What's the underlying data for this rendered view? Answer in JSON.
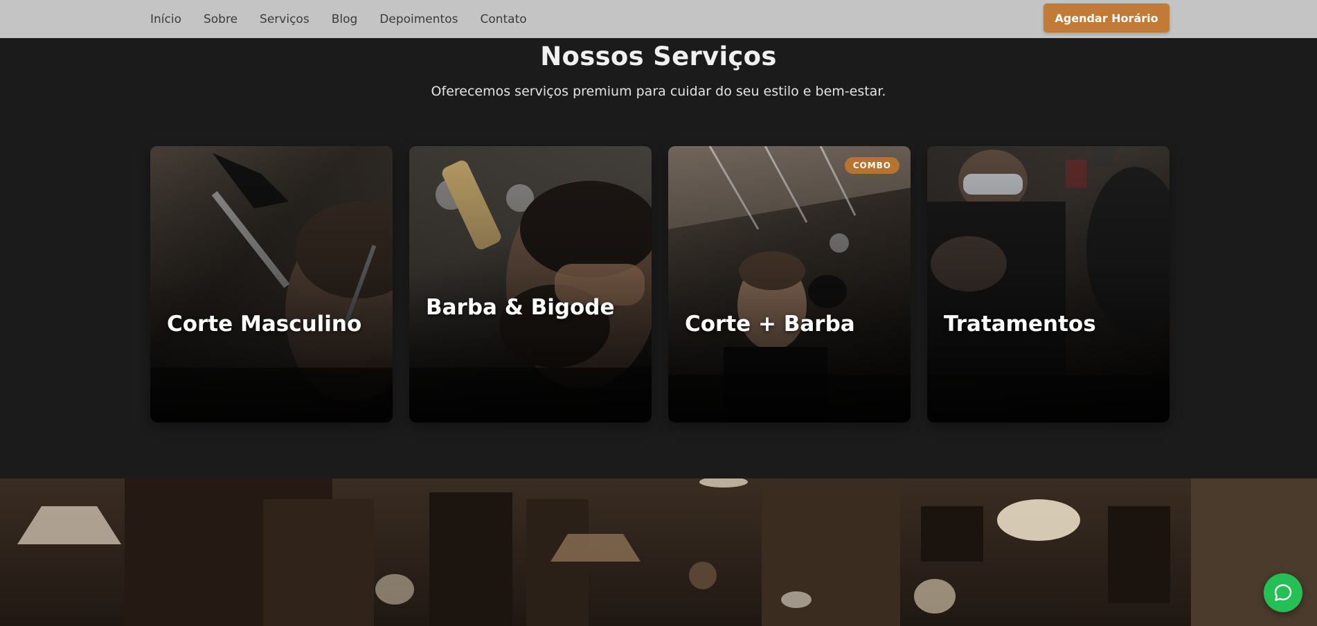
{
  "nav": {
    "links": [
      "Início",
      "Sobre",
      "Serviços",
      "Blog",
      "Depoimentos",
      "Contato"
    ],
    "cta_label": "Agendar Horário"
  },
  "services": {
    "title": "Nossos Serviços",
    "subtitle": "Oferecemos serviços premium para cuidar do seu estilo e bem-estar.",
    "cards": [
      {
        "title": "Corte Masculino",
        "badge": ""
      },
      {
        "title": "Barba & Bigode",
        "badge": ""
      },
      {
        "title": "Corte + Barba",
        "badge": "COMBO"
      },
      {
        "title": "Tratamentos",
        "badge": ""
      }
    ]
  },
  "floating": {
    "icon": "whatsapp-icon"
  },
  "colors": {
    "accent": "#c27a37",
    "background": "#1b1b1b",
    "nav_background": "#c4c4c4",
    "whatsapp": "#25c055"
  }
}
